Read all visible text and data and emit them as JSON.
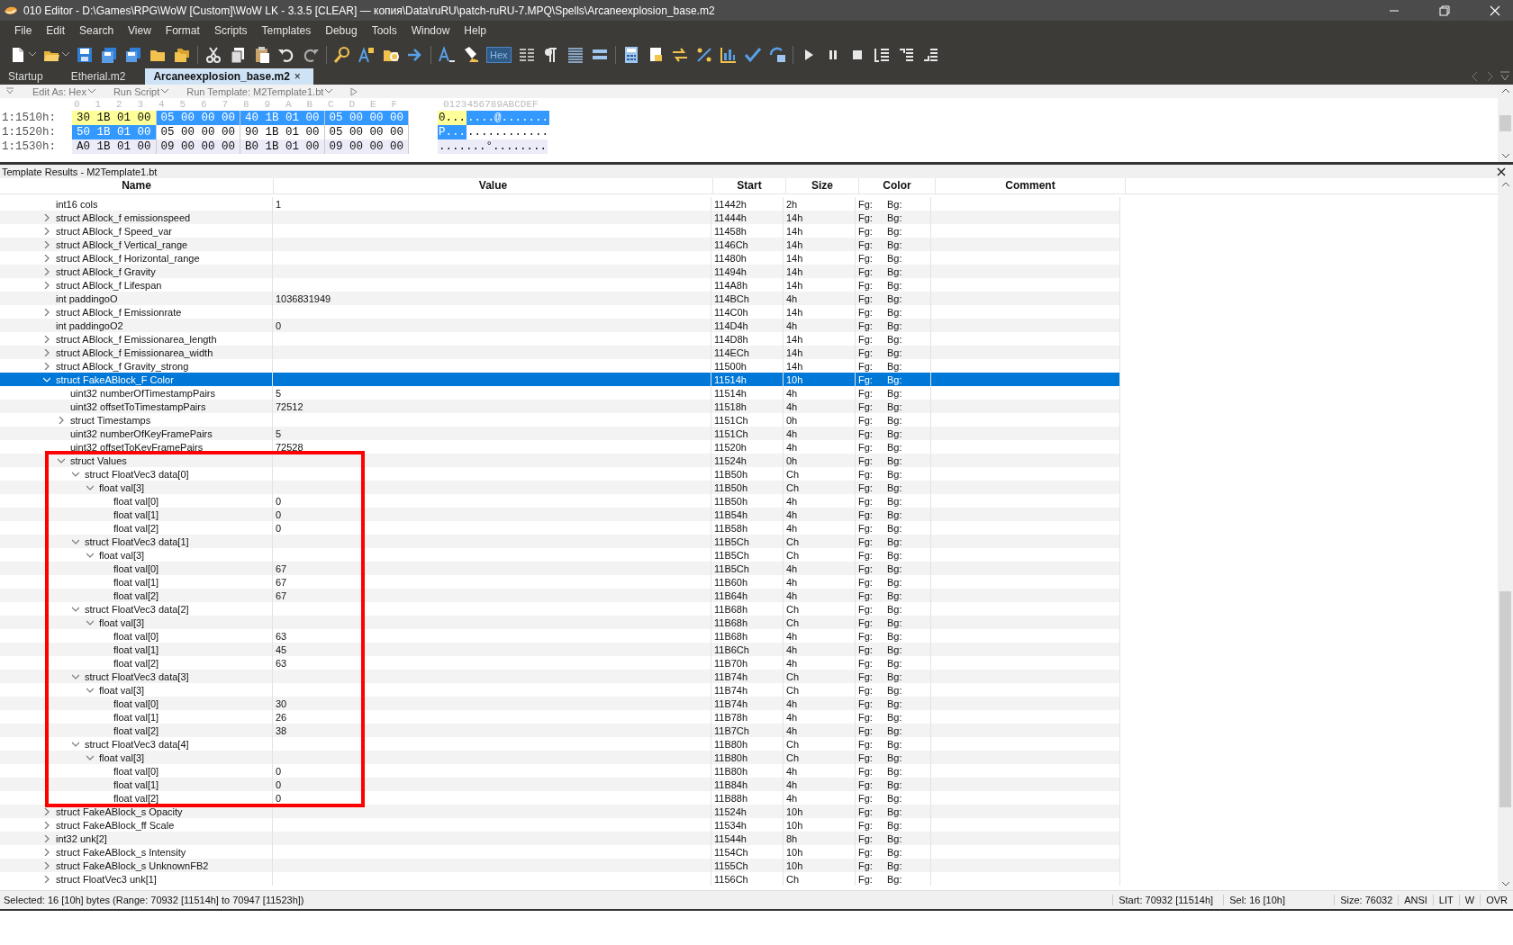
{
  "window": {
    "title": "010 Editor - D:\\Games\\RPG\\WoW [Custom]\\WoW LK - 3.3.5 [CLEAR] — копия\\Data\\ruRU\\patch-ruRU-7.MPQ\\Spells\\Arcaneexplosion_base.m2"
  },
  "menu": [
    "File",
    "Edit",
    "Search",
    "View",
    "Format",
    "Scripts",
    "Templates",
    "Debug",
    "Tools",
    "Window",
    "Help"
  ],
  "toolbar": {
    "hex_button": {
      "label": "Hex",
      "pressed": true
    }
  },
  "tabs": [
    {
      "label": "Startup",
      "selected": false
    },
    {
      "label": "Etherial.m2",
      "selected": false
    },
    {
      "label": "Arcaneexplosion_base.m2",
      "selected": true,
      "close": "×"
    }
  ],
  "hex": {
    "edit_bar": [
      "Edit As: Hex",
      "Run Script",
      "Run Template: M2Template1.bt"
    ],
    "columns": [
      "0",
      "1",
      "2",
      "3",
      "4",
      "5",
      "6",
      "7",
      "8",
      "9",
      "A",
      "B",
      "C",
      "D",
      "E",
      "F"
    ],
    "ascii_header": "0123456789ABCDEF",
    "rows": [
      {
        "address": "1:1510h:",
        "current_line": false,
        "groups": [
          {
            "text": "30 1B 01 00",
            "in_template": true,
            "selected": false
          },
          {
            "text": "05 00 00 00",
            "in_template": false,
            "selected": true
          },
          {
            "text": "40 1B 01 00",
            "in_template": false,
            "selected": true
          },
          {
            "text": "05 00 00 00",
            "in_template": false,
            "selected": true
          }
        ],
        "ascii": [
          {
            "text": "0...",
            "in_template": true,
            "selected": false
          },
          {
            "text": "....@.......",
            "in_template": false,
            "selected": true
          }
        ]
      },
      {
        "address": "1:1520h:",
        "current_line": false,
        "groups": [
          {
            "text": "50 1B 01 00",
            "in_template": false,
            "selected": true
          },
          {
            "text": "05 00 00 00",
            "in_template": false,
            "selected": false
          },
          {
            "text": "90 1B 01 00",
            "in_template": false,
            "selected": false
          },
          {
            "text": "05 00 00 00",
            "in_template": false,
            "selected": false
          }
        ],
        "ascii": [
          {
            "text": "P...",
            "in_template": false,
            "selected": true
          },
          {
            "text": "............",
            "in_template": false,
            "selected": false
          }
        ]
      },
      {
        "address": "1:1530h:",
        "current_line": true,
        "groups": [
          {
            "text": "A0 1B 01 00",
            "in_template": false,
            "selected": false
          },
          {
            "text": "09 00 00 00",
            "in_template": false,
            "selected": false
          },
          {
            "text": "B0 1B 01 00",
            "in_template": false,
            "selected": false
          },
          {
            "text": "09 00 00 00",
            "in_template": false,
            "selected": false
          }
        ],
        "ascii": [
          {
            "text": ".......°........",
            "in_template": false,
            "selected": false
          }
        ]
      }
    ]
  },
  "template": {
    "title": "Template Results - M2Template1.bt",
    "columns": [
      "Name",
      "Value",
      "Start",
      "Size",
      "Color",
      "Comment"
    ],
    "rows": [
      {
        "name": "int16 cols",
        "value": "1",
        "start": "11442h",
        "size": "2h",
        "fg": "Fg:",
        "bg": "Bg:",
        "selected": false
      },
      {
        "name": "struct ABlock_f emissionspeed",
        "start": "11444h",
        "size": "14h",
        "fg": "Fg:",
        "bg": "Bg:",
        "selected": false,
        "expanded": false
      },
      {
        "name": "struct ABlock_f Speed_var",
        "start": "11458h",
        "size": "14h",
        "fg": "Fg:",
        "bg": "Bg:",
        "selected": false,
        "expanded": false
      },
      {
        "name": "struct ABlock_f Vertical_range",
        "start": "1146Ch",
        "size": "14h",
        "fg": "Fg:",
        "bg": "Bg:",
        "selected": false,
        "expanded": false
      },
      {
        "name": "struct ABlock_f Horizontal_range",
        "start": "11480h",
        "size": "14h",
        "fg": "Fg:",
        "bg": "Bg:",
        "selected": false,
        "expanded": false
      },
      {
        "name": "struct ABlock_f Gravity",
        "start": "11494h",
        "size": "14h",
        "fg": "Fg:",
        "bg": "Bg:",
        "selected": false,
        "expanded": false
      },
      {
        "name": "struct ABlock_f Lifespan",
        "start": "114A8h",
        "size": "14h",
        "fg": "Fg:",
        "bg": "Bg:",
        "selected": false,
        "expanded": false
      },
      {
        "name": "int paddingoO",
        "value": "1036831949",
        "start": "114BCh",
        "size": "4h",
        "fg": "Fg:",
        "bg": "Bg:",
        "selected": false
      },
      {
        "name": "struct ABlock_f Emissionrate",
        "start": "114C0h",
        "size": "14h",
        "fg": "Fg:",
        "bg": "Bg:",
        "selected": false,
        "expanded": false
      },
      {
        "name": "int paddingoO2",
        "value": "0",
        "start": "114D4h",
        "size": "4h",
        "fg": "Fg:",
        "bg": "Bg:",
        "selected": false
      },
      {
        "name": "struct ABlock_f Emissionarea_length",
        "start": "114D8h",
        "size": "14h",
        "fg": "Fg:",
        "bg": "Bg:",
        "selected": false,
        "expanded": false
      },
      {
        "name": "struct ABlock_f Emissionarea_width",
        "start": "114ECh",
        "size": "14h",
        "fg": "Fg:",
        "bg": "Bg:",
        "selected": false,
        "expanded": false
      },
      {
        "name": "struct ABlock_f Gravity_strong",
        "start": "11500h",
        "size": "14h",
        "fg": "Fg:",
        "bg": "Bg:",
        "selected": false,
        "expanded": false
      },
      {
        "name": "struct FakeABlock_F Color",
        "start": "11514h",
        "size": "10h",
        "fg": "Fg:",
        "bg": "Bg:",
        "selected": true,
        "expanded": true,
        "children": [
          {
            "name": "uint32 numberOfTimestampPairs",
            "value": "5",
            "start": "11514h",
            "size": "4h",
            "fg": "Fg:",
            "bg": "Bg:",
            "selected": false
          },
          {
            "name": "uint32 offsetToTimestampPairs",
            "value": "72512",
            "start": "11518h",
            "size": "4h",
            "fg": "Fg:",
            "bg": "Bg:",
            "selected": false
          },
          {
            "name": "struct Timestamps",
            "start": "1151Ch",
            "size": "0h",
            "fg": "Fg:",
            "bg": "Bg:",
            "selected": false,
            "expanded": false
          },
          {
            "name": "uint32 numberOfKeyFramePairs",
            "value": "5",
            "start": "1151Ch",
            "size": "4h",
            "fg": "Fg:",
            "bg": "Bg:",
            "selected": false
          },
          {
            "name": "uint32 offsetToKeyFramePairs",
            "value": "72528",
            "start": "11520h",
            "size": "4h",
            "fg": "Fg:",
            "bg": "Bg:",
            "selected": false
          },
          {
            "name": "struct Values",
            "start": "11524h",
            "size": "0h",
            "fg": "Fg:",
            "bg": "Bg:",
            "selected": false,
            "expanded": true,
            "boxed": true,
            "children": [
              {
                "name": "struct FloatVec3 data[0]",
                "start": "11B50h",
                "size": "Ch",
                "fg": "Fg:",
                "bg": "Bg:",
                "selected": false,
                "expanded": true,
                "children": [
                  {
                    "name": "float val[3]",
                    "start": "11B50h",
                    "size": "Ch",
                    "fg": "Fg:",
                    "bg": "Bg:",
                    "selected": false,
                    "expanded": true,
                    "children": [
                      {
                        "name": "float val[0]",
                        "value": "0",
                        "start": "11B50h",
                        "size": "4h",
                        "fg": "Fg:",
                        "bg": "Bg:",
                        "selected": false
                      },
                      {
                        "name": "float val[1]",
                        "value": "0",
                        "start": "11B54h",
                        "size": "4h",
                        "fg": "Fg:",
                        "bg": "Bg:",
                        "selected": false
                      },
                      {
                        "name": "float val[2]",
                        "value": "0",
                        "start": "11B58h",
                        "size": "4h",
                        "fg": "Fg:",
                        "bg": "Bg:",
                        "selected": false
                      }
                    ]
                  }
                ]
              },
              {
                "name": "struct FloatVec3 data[1]",
                "start": "11B5Ch",
                "size": "Ch",
                "fg": "Fg:",
                "bg": "Bg:",
                "selected": false,
                "expanded": true,
                "children": [
                  {
                    "name": "float val[3]",
                    "start": "11B5Ch",
                    "size": "Ch",
                    "fg": "Fg:",
                    "bg": "Bg:",
                    "selected": false,
                    "expanded": true,
                    "children": [
                      {
                        "name": "float val[0]",
                        "value": "67",
                        "start": "11B5Ch",
                        "size": "4h",
                        "fg": "Fg:",
                        "bg": "Bg:",
                        "selected": false
                      },
                      {
                        "name": "float val[1]",
                        "value": "67",
                        "start": "11B60h",
                        "size": "4h",
                        "fg": "Fg:",
                        "bg": "Bg:",
                        "selected": false
                      },
                      {
                        "name": "float val[2]",
                        "value": "67",
                        "start": "11B64h",
                        "size": "4h",
                        "fg": "Fg:",
                        "bg": "Bg:",
                        "selected": false
                      }
                    ]
                  }
                ]
              },
              {
                "name": "struct FloatVec3 data[2]",
                "start": "11B68h",
                "size": "Ch",
                "fg": "Fg:",
                "bg": "Bg:",
                "selected": false,
                "expanded": true,
                "children": [
                  {
                    "name": "float val[3]",
                    "start": "11B68h",
                    "size": "Ch",
                    "fg": "Fg:",
                    "bg": "Bg:",
                    "selected": false,
                    "expanded": true,
                    "children": [
                      {
                        "name": "float val[0]",
                        "value": "63",
                        "start": "11B68h",
                        "size": "4h",
                        "fg": "Fg:",
                        "bg": "Bg:",
                        "selected": false
                      },
                      {
                        "name": "float val[1]",
                        "value": "45",
                        "start": "11B6Ch",
                        "size": "4h",
                        "fg": "Fg:",
                        "bg": "Bg:",
                        "selected": false
                      },
                      {
                        "name": "float val[2]",
                        "value": "63",
                        "start": "11B70h",
                        "size": "4h",
                        "fg": "Fg:",
                        "bg": "Bg:",
                        "selected": false
                      }
                    ]
                  }
                ]
              },
              {
                "name": "struct FloatVec3 data[3]",
                "start": "11B74h",
                "size": "Ch",
                "fg": "Fg:",
                "bg": "Bg:",
                "selected": false,
                "expanded": true,
                "children": [
                  {
                    "name": "float val[3]",
                    "start": "11B74h",
                    "size": "Ch",
                    "fg": "Fg:",
                    "bg": "Bg:",
                    "selected": false,
                    "expanded": true,
                    "children": [
                      {
                        "name": "float val[0]",
                        "value": "30",
                        "start": "11B74h",
                        "size": "4h",
                        "fg": "Fg:",
                        "bg": "Bg:",
                        "selected": false
                      },
                      {
                        "name": "float val[1]",
                        "value": "26",
                        "start": "11B78h",
                        "size": "4h",
                        "fg": "Fg:",
                        "bg": "Bg:",
                        "selected": false
                      },
                      {
                        "name": "float val[2]",
                        "value": "38",
                        "start": "11B7Ch",
                        "size": "4h",
                        "fg": "Fg:",
                        "bg": "Bg:",
                        "selected": false
                      }
                    ]
                  }
                ]
              },
              {
                "name": "struct FloatVec3 data[4]",
                "start": "11B80h",
                "size": "Ch",
                "fg": "Fg:",
                "bg": "Bg:",
                "selected": false,
                "expanded": true,
                "children": [
                  {
                    "name": "float val[3]",
                    "start": "11B80h",
                    "size": "Ch",
                    "fg": "Fg:",
                    "bg": "Bg:",
                    "selected": false,
                    "expanded": true,
                    "children": [
                      {
                        "name": "float val[0]",
                        "value": "0",
                        "start": "11B80h",
                        "size": "4h",
                        "fg": "Fg:",
                        "bg": "Bg:",
                        "selected": false
                      },
                      {
                        "name": "float val[1]",
                        "value": "0",
                        "start": "11B84h",
                        "size": "4h",
                        "fg": "Fg:",
                        "bg": "Bg:",
                        "selected": false
                      },
                      {
                        "name": "float val[2]",
                        "value": "0",
                        "start": "11B88h",
                        "size": "4h",
                        "fg": "Fg:",
                        "bg": "Bg:",
                        "selected": false
                      }
                    ]
                  }
                ]
              }
            ]
          }
        ]
      },
      {
        "name": "struct FakeABlock_s Opacity",
        "start": "11524h",
        "size": "10h",
        "fg": "Fg:",
        "bg": "Bg:",
        "selected": false,
        "expanded": false
      },
      {
        "name": "struct FakeABlock_ff Scale",
        "start": "11534h",
        "size": "10h",
        "fg": "Fg:",
        "bg": "Bg:",
        "selected": false,
        "expanded": false
      },
      {
        "name": "int32 unk[2]",
        "start": "11544h",
        "size": "8h",
        "fg": "Fg:",
        "bg": "Bg:",
        "selected": false,
        "expanded": false
      },
      {
        "name": "struct FakeABlock_s Intensity",
        "start": "1154Ch",
        "size": "10h",
        "fg": "Fg:",
        "bg": "Bg:",
        "selected": false,
        "expanded": false
      },
      {
        "name": "struct FakeABlock_s UnknownFB2",
        "start": "1155Ch",
        "size": "10h",
        "fg": "Fg:",
        "bg": "Bg:",
        "selected": false,
        "expanded": false
      },
      {
        "name": "struct FloatVec3 unk[1]",
        "start": "1156Ch",
        "size": "Ch",
        "fg": "Fg:",
        "bg": "Bg:",
        "selected": false,
        "expanded": false
      }
    ]
  },
  "status_bar": {
    "selection": "Selected: 16 [10h] bytes (Range: 70932 [11514h] to 70947 [11523h])",
    "start": "Start: 70932 [11514h]",
    "sel": "Sel: 16 [10h]",
    "size": "Size: 76032",
    "encoding": "ANSI",
    "endian": "LIT",
    "width": "W",
    "mode": "OVR"
  }
}
